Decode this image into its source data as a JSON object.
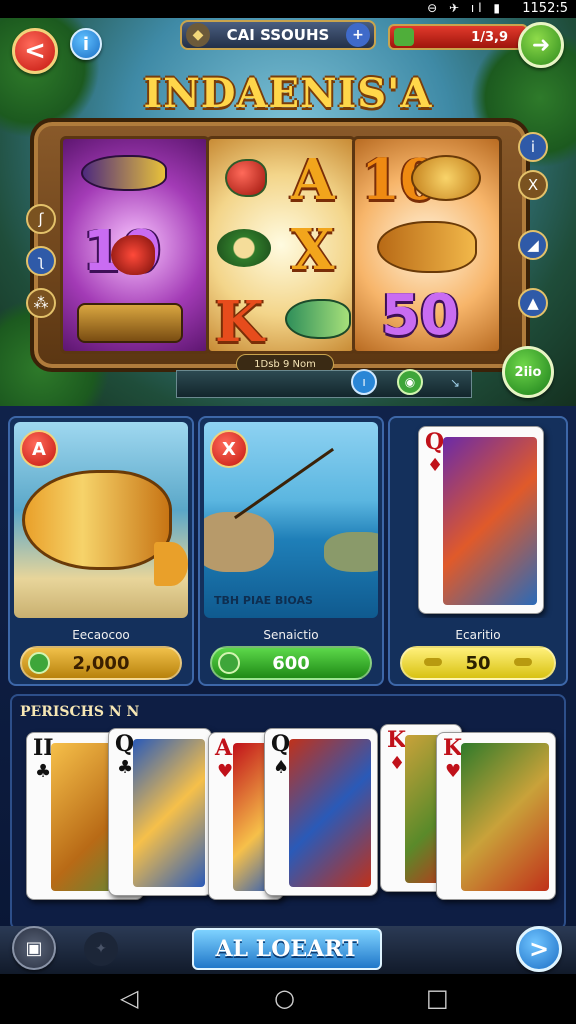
{
  "status_bar": {
    "icons": "⊖ ✈ ıl ▮",
    "time": "1152:5"
  },
  "header": {
    "back_label": "<",
    "info_label": "i",
    "title_plate": "CAI SSOUHS",
    "plate_add_label": "+",
    "coin_value": "1/3,9",
    "go_label": "➜"
  },
  "game": {
    "title": "INDAENIS'A",
    "reel_caption": "1Dsb 9 Nom",
    "symbols": [
      "10",
      "A",
      "X",
      "K",
      "10",
      "50"
    ],
    "spin_label": "2iio",
    "left_side_icons": [
      "ʃ",
      "ʅ",
      "⁂"
    ],
    "right_side_icons": [
      "i",
      "X",
      "◢",
      "▲"
    ],
    "control_icons": [
      "ı",
      "◉",
      "↘"
    ]
  },
  "cards": [
    {
      "badge": "A",
      "label": "Eecaocoo",
      "value": "2,000",
      "pill_color": "#c98f1c"
    },
    {
      "badge": "X",
      "label": "Senaictio",
      "value": "600",
      "art_text": "TBH PIAE BIOAS",
      "pill_color": "#3fae2c"
    },
    {
      "label": "Ecaritio",
      "value": "50",
      "pill_color": "#e5d428"
    }
  ],
  "section": {
    "title": "PERISCHS N N",
    "playing_cards": [
      {
        "rank": "II",
        "suit": "♣"
      },
      {
        "rank": "Q",
        "suit": "♣"
      },
      {
        "rank": "A",
        "suit": "♥"
      },
      {
        "rank": "Q",
        "suit": "♠"
      },
      {
        "rank": "K",
        "suit": "♦"
      },
      {
        "rank": "K",
        "suit": "♥"
      }
    ]
  },
  "bottom": {
    "cta_label": "AL LOEART",
    "next_label": ">"
  },
  "nav": {
    "back": "◁",
    "home": "○",
    "recents": "□"
  }
}
